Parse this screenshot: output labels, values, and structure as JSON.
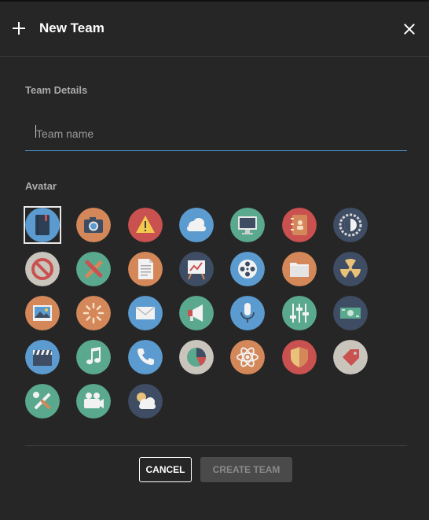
{
  "dialog": {
    "title": "New Team",
    "close_label": "close"
  },
  "team_details": {
    "label": "Team Details",
    "input_value": "",
    "placeholder": "Team name"
  },
  "avatar": {
    "label": "Avatar",
    "selected_index": 0,
    "icons": [
      {
        "name": "notebook-icon",
        "bg": "#5b9bcf"
      },
      {
        "name": "camera-icon",
        "bg": "#d4885a"
      },
      {
        "name": "warning-icon",
        "bg": "#c9514f"
      },
      {
        "name": "cloud-icon",
        "bg": "#5b9bcf"
      },
      {
        "name": "monitor-icon",
        "bg": "#5aa98f"
      },
      {
        "name": "address-book-icon",
        "bg": "#c9514f"
      },
      {
        "name": "brightness-icon",
        "bg": "#3e4d63"
      },
      {
        "name": "no-entry-icon",
        "bg": "#c9c4bc"
      },
      {
        "name": "design-tools-icon",
        "bg": "#5aa98f"
      },
      {
        "name": "document-icon",
        "bg": "#d4885a"
      },
      {
        "name": "presentation-icon",
        "bg": "#3e4d63"
      },
      {
        "name": "film-reel-icon",
        "bg": "#5b9bcf"
      },
      {
        "name": "folder-icon",
        "bg": "#d4885a"
      },
      {
        "name": "radiation-icon",
        "bg": "#3e4d63"
      },
      {
        "name": "picture-icon",
        "bg": "#d4885a"
      },
      {
        "name": "loading-icon",
        "bg": "#d4885a"
      },
      {
        "name": "mail-icon",
        "bg": "#5b9bcf"
      },
      {
        "name": "megaphone-icon",
        "bg": "#5aa98f"
      },
      {
        "name": "microphone-icon",
        "bg": "#5b9bcf"
      },
      {
        "name": "sliders-icon",
        "bg": "#5aa98f"
      },
      {
        "name": "money-icon",
        "bg": "#3e4d63"
      },
      {
        "name": "clapperboard-icon",
        "bg": "#5b9bcf"
      },
      {
        "name": "music-icon",
        "bg": "#5aa98f"
      },
      {
        "name": "phone-icon",
        "bg": "#5b9bcf"
      },
      {
        "name": "pie-chart-icon",
        "bg": "#c9c4bc"
      },
      {
        "name": "atom-icon",
        "bg": "#d4885a"
      },
      {
        "name": "shield-icon",
        "bg": "#c9514f"
      },
      {
        "name": "tag-icon",
        "bg": "#c9c4bc"
      },
      {
        "name": "tools-icon",
        "bg": "#5aa98f"
      },
      {
        "name": "video-camera-icon",
        "bg": "#5aa98f"
      },
      {
        "name": "weather-icon",
        "bg": "#3e4d63"
      }
    ]
  },
  "actions": {
    "cancel_label": "CANCEL",
    "create_label": "CREATE TEAM"
  }
}
